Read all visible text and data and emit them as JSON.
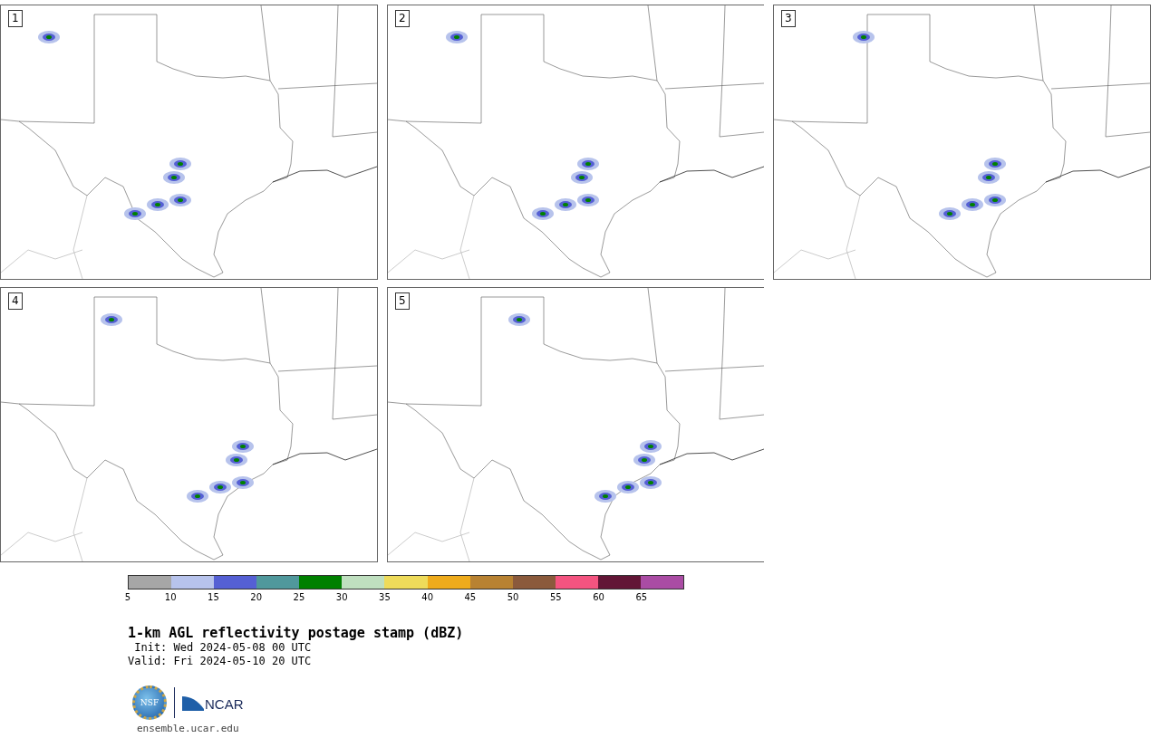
{
  "panels": [
    {
      "label": "1"
    },
    {
      "label": "2"
    },
    {
      "label": "3"
    },
    {
      "label": "4"
    },
    {
      "label": "5"
    }
  ],
  "colorbar": {
    "segments": [
      {
        "color": "#a6a6a6"
      },
      {
        "color": "#b7c3ec"
      },
      {
        "color": "#5560d4"
      },
      {
        "color": "#50989c"
      },
      {
        "color": "#008000"
      },
      {
        "color": "#bfdfbf"
      },
      {
        "color": "#eedb5a"
      },
      {
        "color": "#eeab1c"
      },
      {
        "color": "#b88232"
      },
      {
        "color": "#8b5a3c"
      },
      {
        "color": "#f45480"
      },
      {
        "color": "#621636"
      },
      {
        "color": "#aa4ca4"
      }
    ],
    "ticks": [
      "5",
      "10",
      "15",
      "20",
      "25",
      "30",
      "35",
      "40",
      "45",
      "50",
      "55",
      "60",
      "65"
    ]
  },
  "title": "1-km AGL reflectivity postage stamp (dBZ)",
  "init": " Init: Wed 2024-05-08 00 UTC",
  "valid": "Valid: Fri 2024-05-10 20 UTC",
  "logos": {
    "nsf": "NSF",
    "ncar": "NCAR"
  },
  "website": "ensemble.ucar.edu"
}
